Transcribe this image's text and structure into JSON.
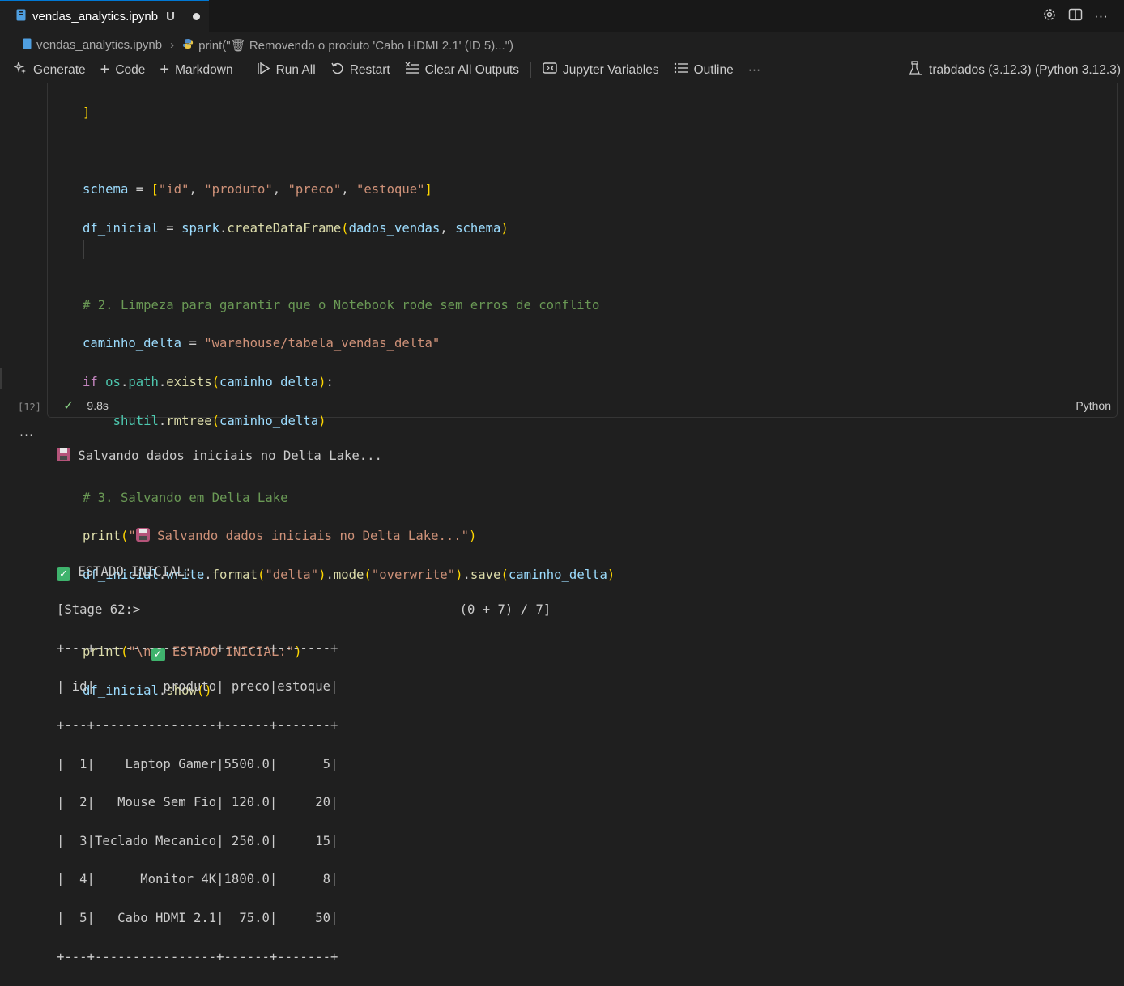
{
  "tab": {
    "filename": "vendas_analytics.ipynb",
    "status": "U"
  },
  "breadcrumb": {
    "file": "vendas_analytics.ipynb",
    "cell": "print(\"🗑 Removendo o produto 'Cabo HDMI 2.1' (ID 5)...\")"
  },
  "toolbar": {
    "generate": "Generate",
    "code": "Code",
    "markdown": "Markdown",
    "run_all": "Run All",
    "restart": "Restart",
    "clear_outputs": "Clear All Outputs",
    "variables": "Jupyter Variables",
    "outline": "Outline",
    "more": "···",
    "kernel": "trabdados (3.12.3) (Python 3.12.3)"
  },
  "cell": {
    "exec_count": "[12]",
    "duration": "9.8s",
    "language": "Python",
    "lines": {
      "l1": "]",
      "l3_schema": "schema",
      "l3_eq": " = ",
      "l3_open": "[",
      "l3_s1": "\"id\"",
      "l3_s2": "\"produto\"",
      "l3_s3": "\"preco\"",
      "l3_s4": "\"estoque\"",
      "l3_close": "]",
      "l4_var": "df_inicial",
      "l4_eq": " = ",
      "l4_obj": "spark",
      "l4_fn": "createDataFrame",
      "l4_a1": "dados_vendas",
      "l4_a2": "schema",
      "l6_comment": "# 2. Limpeza para garantir que o Notebook rode sem erros de conflito",
      "l7_var": "caminho_delta",
      "l7_str": "\"warehouse/tabela_vendas_delta\"",
      "l8_kw": "if",
      "l8_os": "os",
      "l8_path": "path",
      "l8_fn": "exists",
      "l8_arg": "caminho_delta",
      "l9_mod": "shutil",
      "l9_fn": "rmtree",
      "l9_arg": "caminho_delta",
      "l11_comment": "# 3. Salvando em Delta Lake",
      "l12_fn": "print",
      "l12_str_a": "\"",
      "l12_str_b": " Salvando dados iniciais no Delta Lake...\"",
      "l13_var": "df_inicial",
      "l13_write": "write",
      "l13_format": "format",
      "l13_fmt_arg": "\"delta\"",
      "l13_mode": "mode",
      "l13_mode_arg": "\"overwrite\"",
      "l13_save": "save",
      "l13_save_arg": "caminho_delta",
      "l15_fn": "print",
      "l15_str_a": "\"\\n",
      "l15_str_b": " ESTADO INICIAL:\"",
      "l16_var": "df_inicial",
      "l16_fn": "show"
    }
  },
  "output": {
    "line1": " Salvando dados iniciais no Delta Lake...",
    "line2": " ESTADO INICIAL:",
    "stage": "[Stage 62:>                                          (0 + 7) / 7]",
    "table": [
      "+---+----------------+------+-------+",
      "| id|         produto| preco|estoque|",
      "+---+----------------+------+-------+",
      "|  1|    Laptop Gamer|5500.0|      5|",
      "|  2|   Mouse Sem Fio| 120.0|     20|",
      "|  3|Teclado Mecanico| 250.0|     15|",
      "|  4|      Monitor 4K|1800.0|      8|",
      "|  5|   Cabo HDMI 2.1|  75.0|     50|",
      "+---+----------------+------+-------+"
    ]
  }
}
